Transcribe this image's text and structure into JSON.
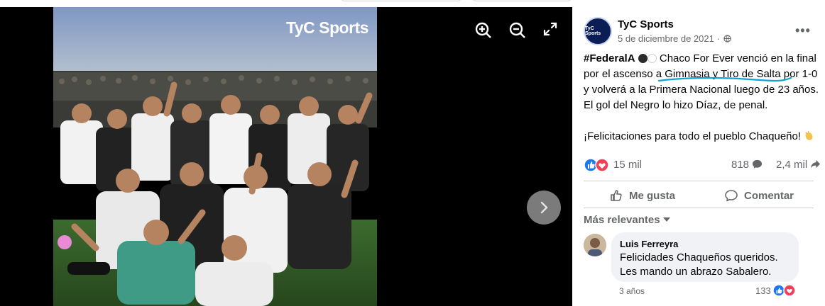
{
  "viewer": {
    "wordmark": "TyC Sports",
    "controls": [
      "zoom-in-icon",
      "zoom-out-icon",
      "fullscreen-icon"
    ],
    "next_icon": "chevron-right-icon"
  },
  "post": {
    "page_name": "TyC Sports",
    "avatar_text": "TyC Sports",
    "date": "5 de diciembre de 2021",
    "date_separator": "·",
    "audience_icon": "globe-icon",
    "more_label": "•••",
    "text": {
      "hashtag": "#FederalA",
      "line1_rest": " Chaco For Ever venció en la final",
      "line2": "por el ascenso a Gimnasia y Tiro de Salta por 1-0",
      "line3": "y volverá a la Primera Nacional luego de 23 años.",
      "line4": "El gol del Negro lo hizo Díaz, de penal.",
      "line5": "¡Felicitaciones para todo el pueblo Chaqueño!"
    },
    "reactions_count": "15 mil",
    "comments_count": "818",
    "shares_count": "2,4 mil",
    "actions": {
      "like": "Me gusta",
      "comment": "Comentar"
    },
    "sort_label": "Más relevantes"
  },
  "comment": {
    "author": "Luis Ferreyra",
    "line1": "Felicidades Chaqueños queridos.",
    "line2": "Les mando un abrazo Sabalero.",
    "time": "3 años",
    "reactions": "133"
  },
  "colors": {
    "facebook_blue": "#1877f2",
    "love_red": "#f33e58",
    "muted_text": "#65676b",
    "annotation_cyan": "#0fa3d6"
  }
}
